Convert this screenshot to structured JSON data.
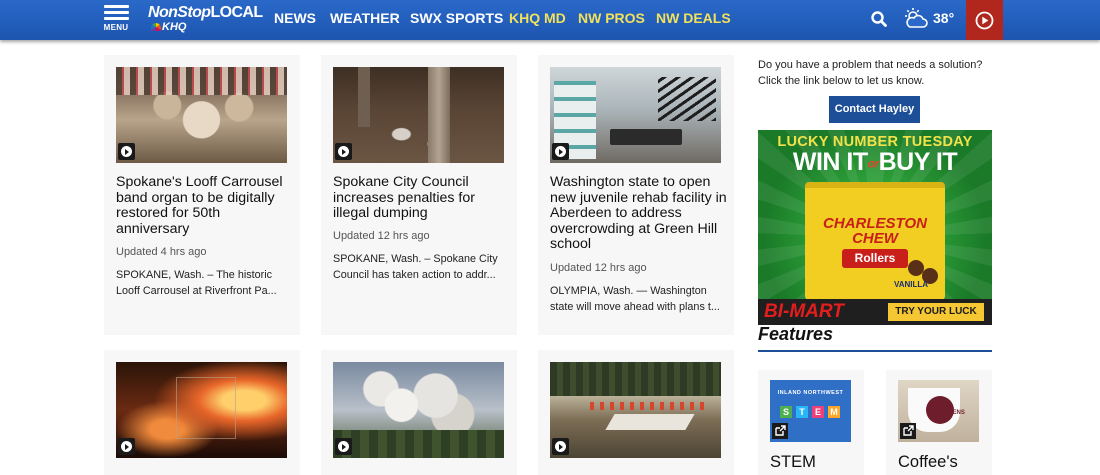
{
  "header": {
    "menu_label": "MENU",
    "logo": {
      "line1_a": "NonStop",
      "line1_b": "LOCAL",
      "line2": "KHQ"
    },
    "nav": [
      {
        "label": "NEWS",
        "highlight": false
      },
      {
        "label": "WEATHER",
        "highlight": false
      },
      {
        "label": "SWX SPORTS",
        "highlight": false
      },
      {
        "label": "KHQ MD",
        "highlight": true
      },
      {
        "label": "NW PROS",
        "highlight": true
      },
      {
        "label": "NW DEALS",
        "highlight": true
      }
    ],
    "weather_temp": "38°",
    "colors": {
      "bar": "#1f5bbf",
      "highlight": "#f2e15a",
      "play_tile": "#b1271d"
    }
  },
  "articles": [
    {
      "headline": "Spokane's Looff Carrousel band organ to be digitally restored for 50th anniversary",
      "updated": "Updated 4 hrs ago",
      "summary": "SPOKANE, Wash. – The historic Looff Carrousel at Riverfront Pa..."
    },
    {
      "headline": "Spokane City Council increases penalties for illegal dumping",
      "updated": "Updated 12 hrs ago",
      "summary": "SPOKANE, Wash. – Spokane City Council has taken action to addr..."
    },
    {
      "headline": "Washington state to open new juvenile rehab facility in Aberdeen to address overcrowding at Green Hill school",
      "updated": "Updated 12 hrs ago",
      "summary": "OLYMPIA, Wash. — Washington state will move ahead with plans t..."
    },
    {
      "headline": "",
      "updated": "",
      "summary": ""
    },
    {
      "headline": "",
      "updated": "",
      "summary": ""
    },
    {
      "headline": "",
      "updated": "",
      "summary": ""
    }
  ],
  "sidebar": {
    "promo_text": "Do you have a problem that needs a solution? Click the link below to let us know.",
    "contact_button": "Contact Hayley",
    "ad": {
      "line1": "LUCKY NUMBER TUESDAY",
      "line2a": "WIN IT",
      "line2_or": "or",
      "line2b": "BUY IT",
      "brand": "CHARLESTON CHEW",
      "product": "Rollers",
      "flavor": "VANILLA",
      "store": "BI-MART",
      "cta": "TRY YOUR LUCK"
    },
    "features_title": "Features",
    "features": [
      {
        "title": "STEM",
        "thumb_text": "INLAND NORTHWEST",
        "letters": [
          "S",
          "T",
          "E",
          "M"
        ]
      },
      {
        "title": "Coffee's",
        "thumb_text": "CRAVENS"
      }
    ]
  }
}
